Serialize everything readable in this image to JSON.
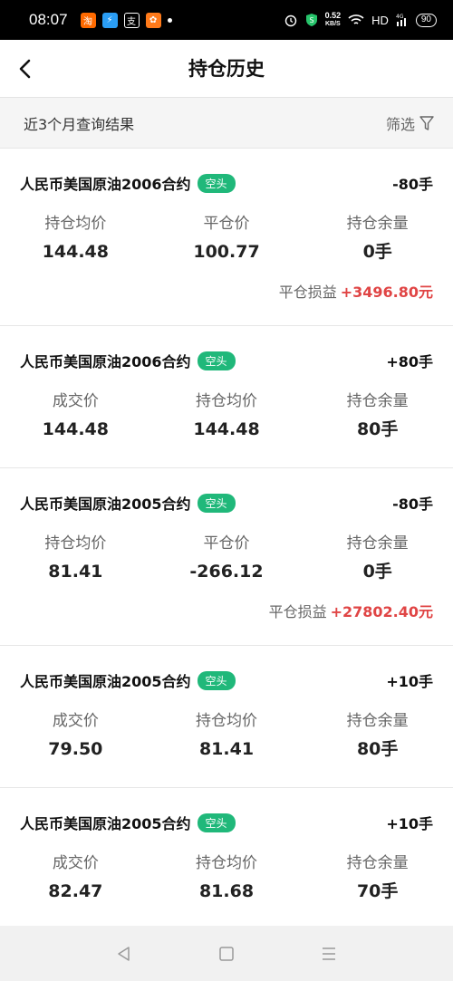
{
  "status_bar": {
    "time": "08:07",
    "net_speed": "0.52",
    "net_unit": "KB/S",
    "network": "HD",
    "signal": "4G",
    "battery": "90",
    "app_icons": [
      {
        "name": "taobao-icon",
        "glyph": "淘",
        "color": "#ff6a00"
      },
      {
        "name": "shield-app-icon",
        "glyph": "⚡",
        "color": "#2a9df4"
      },
      {
        "name": "alipay-icon",
        "glyph": "支",
        "color": "#000000"
      },
      {
        "name": "orange-app-icon",
        "glyph": "✿",
        "color": "#ff7a1a"
      }
    ]
  },
  "header": {
    "title": "持仓历史",
    "back_icon": "chevron-left-icon"
  },
  "filter": {
    "caption": "近3个月查询结果",
    "button_label": "筛选",
    "icon": "filter-icon"
  },
  "colors": {
    "badge": "#20b87a",
    "profit": "#e04545"
  },
  "records": [
    {
      "contract": "人民币美国原油2006合约",
      "badge": "空头",
      "lots": "-80手",
      "columns": [
        {
          "label": "持仓均价",
          "value": "144.48"
        },
        {
          "label": "平仓价",
          "value": "100.77"
        },
        {
          "label": "持仓余量",
          "value": "0手"
        }
      ],
      "pnl_label": "平仓损益",
      "pnl_value": "+3496.80元"
    },
    {
      "contract": "人民币美国原油2006合约",
      "badge": "空头",
      "lots": "+80手",
      "columns": [
        {
          "label": "成交价",
          "value": "144.48"
        },
        {
          "label": "持仓均价",
          "value": "144.48"
        },
        {
          "label": "持仓余量",
          "value": "80手"
        }
      ]
    },
    {
      "contract": "人民币美国原油2005合约",
      "badge": "空头",
      "lots": "-80手",
      "columns": [
        {
          "label": "持仓均价",
          "value": "81.41"
        },
        {
          "label": "平仓价",
          "value": "-266.12"
        },
        {
          "label": "持仓余量",
          "value": "0手"
        }
      ],
      "pnl_label": "平仓损益",
      "pnl_value": "+27802.40元"
    },
    {
      "contract": "人民币美国原油2005合约",
      "badge": "空头",
      "lots": "+10手",
      "columns": [
        {
          "label": "成交价",
          "value": "79.50"
        },
        {
          "label": "持仓均价",
          "value": "81.41"
        },
        {
          "label": "持仓余量",
          "value": "80手"
        }
      ]
    },
    {
      "contract": "人民币美国原油2005合约",
      "badge": "空头",
      "lots": "+10手",
      "columns": [
        {
          "label": "成交价",
          "value": "82.47"
        },
        {
          "label": "持仓均价",
          "value": "81.68"
        },
        {
          "label": "持仓余量",
          "value": "70手"
        }
      ]
    }
  ],
  "system_nav": {
    "back_icon": "triangle-back-icon",
    "home_icon": "square-home-icon",
    "menu_icon": "hamburger-menu-icon"
  }
}
